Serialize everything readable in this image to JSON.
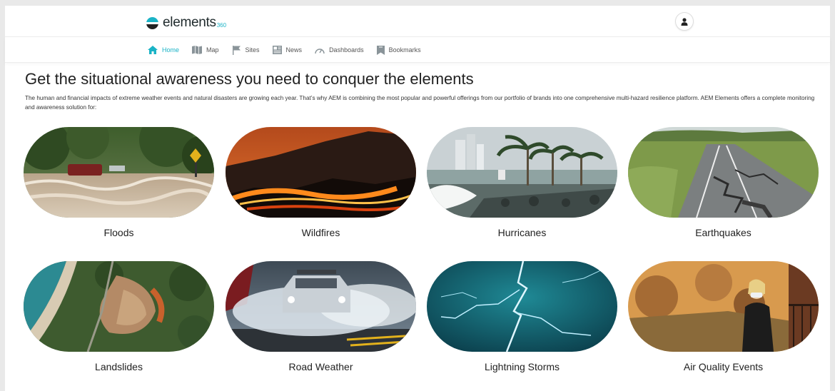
{
  "brand": {
    "name": "elements",
    "suffix": "360",
    "accent": "#1ab3c6"
  },
  "header": {
    "user_icon": "user-icon"
  },
  "nav": {
    "items": [
      {
        "label": "Home",
        "icon": "home-icon",
        "active": true
      },
      {
        "label": "Map",
        "icon": "map-icon"
      },
      {
        "label": "Sites",
        "icon": "flag-icon"
      },
      {
        "label": "News",
        "icon": "news-icon"
      },
      {
        "label": "Dashboards",
        "icon": "gauge-icon"
      },
      {
        "label": "Bookmarks",
        "icon": "bookmark-icon"
      }
    ]
  },
  "hero": {
    "title": "Get the situational awareness you need to conquer the elements",
    "intro": "The human and financial impacts of extreme weather events and natural disasters are growing each year. That’s why AEM is combining the most popular and powerful offerings from our portfolio of brands into one comprehensive multi-hazard resilience platform. AEM Elements offers a complete monitoring and awareness solution for:"
  },
  "hazards": [
    {
      "label": "Floods"
    },
    {
      "label": "Wildfires"
    },
    {
      "label": "Hurricanes"
    },
    {
      "label": "Earthquakes"
    },
    {
      "label": "Landslides"
    },
    {
      "label": "Road Weather"
    },
    {
      "label": "Lightning Storms"
    },
    {
      "label": "Air Quality Events"
    }
  ]
}
